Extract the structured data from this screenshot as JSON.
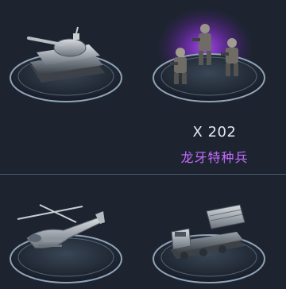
{
  "units": [
    {
      "id": "tank",
      "icon": "tank-icon"
    },
    {
      "id": "special-forces",
      "icon": "soldiers-icon",
      "count": "X 202",
      "name": "龙牙特种兵",
      "name_color": "#c56bff"
    },
    {
      "id": "helicopter",
      "icon": "helicopter-icon"
    },
    {
      "id": "rocket-launcher",
      "icon": "rocket-launcher-icon"
    }
  ],
  "colors": {
    "background": "#1d2430",
    "pedestal_rim": "#8fa3b8",
    "selection_glow": "#b14cff"
  }
}
